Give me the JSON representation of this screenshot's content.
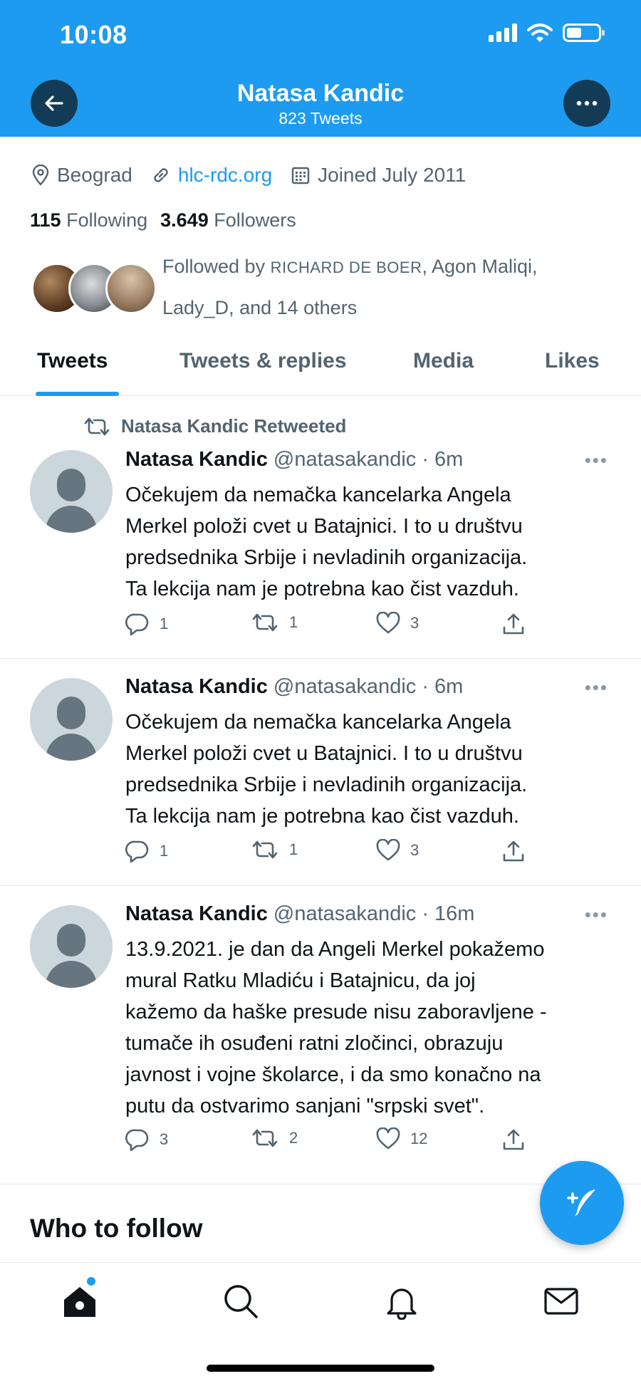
{
  "status_bar": {
    "time": "10:08"
  },
  "header": {
    "title": "Natasa Kandic",
    "subtitle": "823 Tweets"
  },
  "profile": {
    "location": "Beograd",
    "website": "hlc-rdc.org",
    "joined": "Joined July 2011",
    "following_count": "115",
    "following_label": "Following",
    "followers_count": "3.649",
    "followers_label": "Followers",
    "followed_by_prefix": "Followed by",
    "followed_by_name1": "RICHARD DE BOER",
    "followed_by_rest": ", Agon Maliqi,",
    "followed_by_line2": "Lady_D, and 14 others"
  },
  "tabs": [
    {
      "label": "Tweets",
      "active": true
    },
    {
      "label": "Tweets & replies",
      "active": false
    },
    {
      "label": "Media",
      "active": false
    },
    {
      "label": "Likes",
      "active": false
    }
  ],
  "tweets": [
    {
      "retweet_label": "Natasa Kandic Retweeted",
      "name": "Natasa Kandic",
      "handle": "@natasakandic",
      "time": "· 6m",
      "lines": [
        "Očekujem da nemačka kancelarka Angela",
        "Merkel položi cvet u Batajnici. I to u društvu",
        "predsednika Srbije i nevladinih organizacija.",
        "Ta lekcija nam je potrebna kao čist vazduh."
      ],
      "replies": "1",
      "retweets": "1",
      "likes": "3"
    },
    {
      "name": "Natasa Kandic",
      "handle": "@natasakandic",
      "time": "· 6m",
      "lines": [
        "Očekujem da nemačka kancelarka Angela",
        "Merkel položi cvet u Batajnici. I to u društvu",
        "predsednika Srbije i nevladinih organizacija.",
        "Ta lekcija nam je potrebna kao čist vazduh."
      ],
      "replies": "1",
      "retweets": "1",
      "likes": "3"
    },
    {
      "name": "Natasa Kandic",
      "handle": "@natasakandic",
      "time": "· 16m",
      "lines": [
        "13.9.2021. je dan da Angeli Merkel pokažemo",
        "mural Ratku Mladiću i Batajnicu, da joj",
        "kažemo da haške presude nisu zaboravljene -",
        "tumače ih osuđeni ratni zločinci, obrazuju",
        "javnost i vojne školarce, i da smo konačno na",
        "putu da ostvarimo sanjani \"srpski svet\"."
      ],
      "replies": "3",
      "retweets": "2",
      "likes": "12"
    }
  ],
  "who_to_follow": "Who to follow",
  "colors": {
    "accent": "#1d9bf0",
    "text": "#0f1419",
    "muted": "#536471"
  }
}
